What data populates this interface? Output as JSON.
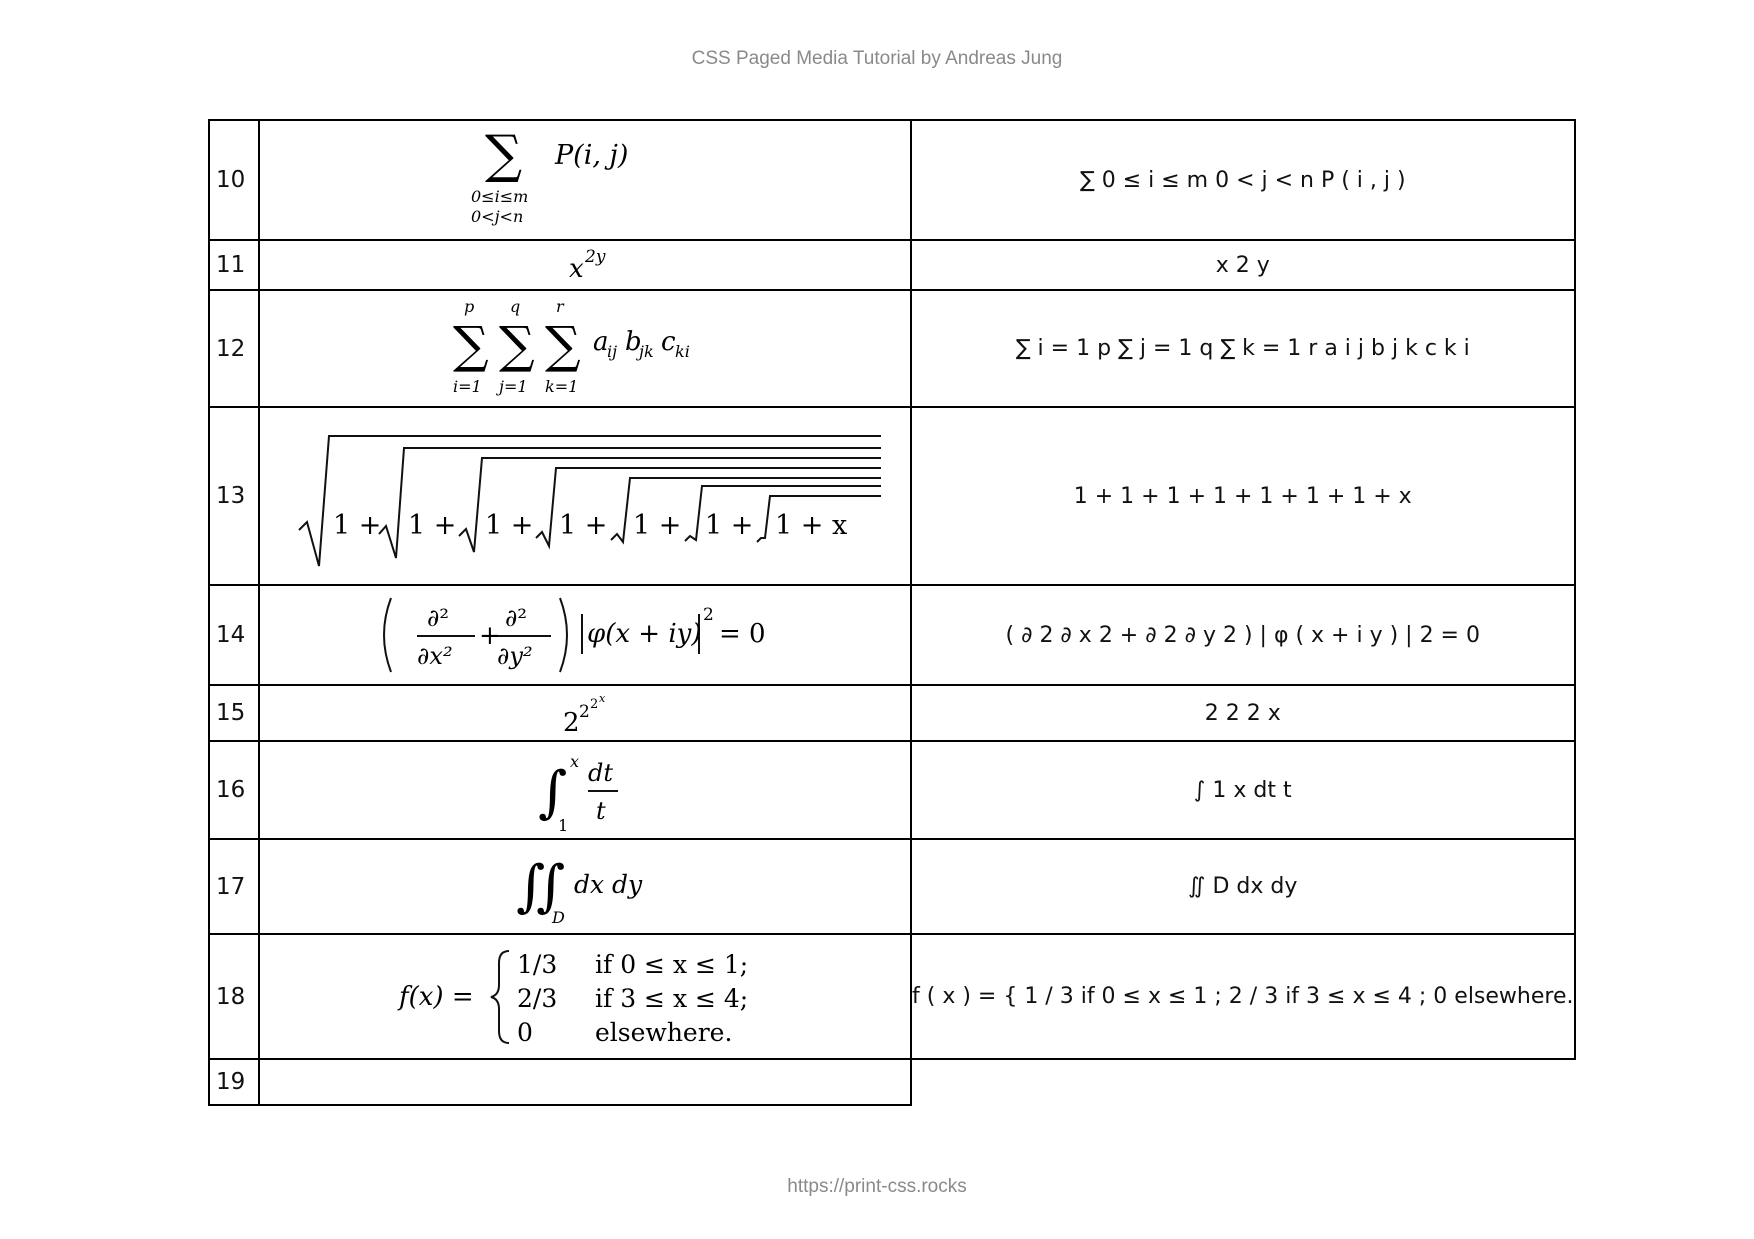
{
  "header": {
    "running_title": "CSS Paged Media Tutorial by Andreas Jung"
  },
  "footer": {
    "url": "https://print-css.rocks"
  },
  "rows": [
    {
      "number": "10",
      "formula": {
        "main": "P(i, j)",
        "sub1": "0≤i≤m",
        "sub2": "0<j<n",
        "op": "∑"
      },
      "text": "∑ 0 ≤ i ≤ m 0 < j < n P ( i , j )"
    },
    {
      "number": "11",
      "formula": {
        "base": "x",
        "exp": "2y"
      },
      "text": "x 2 y"
    },
    {
      "number": "12",
      "formula": {
        "op": "∑",
        "sup1": "p",
        "sub1": "i=1",
        "sup2": "q",
        "sub2": "j=1",
        "sup3": "r",
        "sub3": "k=1",
        "a": "a",
        "a_sub": "ij",
        "b": "b",
        "b_sub": "jk",
        "c": "c",
        "c_sub": "ki"
      },
      "text": "∑ i = 1 p ∑ j = 1 q ∑ k = 1 r a i j b j k c k i"
    },
    {
      "number": "13",
      "formula": {
        "term": "1 +",
        "last": "1 + x"
      },
      "text": "1 + 1 + 1 + 1 + 1 + 1 + 1 + x"
    },
    {
      "number": "14",
      "formula": {
        "d2": "∂²",
        "dx2": "∂x²",
        "dy2": "∂y²",
        "plus": "+",
        "phi": "φ(x + iy)",
        "pow": "2",
        "eq": "= 0"
      },
      "text": "( ∂ 2 ∂ x 2 + ∂ 2 ∂ y 2 ) | φ ( x + i y ) | 2 = 0"
    },
    {
      "number": "15",
      "formula": {
        "b1": "2",
        "b2": "2",
        "b3": "2",
        "b4": "x"
      },
      "text": "2 2 2 x"
    },
    {
      "number": "16",
      "formula": {
        "upper": "x",
        "lower": "1",
        "num": "dt",
        "den": "t"
      },
      "text": "∫ 1 x dt t"
    },
    {
      "number": "17",
      "formula": {
        "region": "D",
        "body": "dx dy"
      },
      "text": "∬ D dx dy"
    },
    {
      "number": "18",
      "formula": {
        "lhs": "f(x) =",
        "v1": "1/3",
        "c1": "if 0 ≤ x ≤ 1;",
        "v2": "2/3",
        "c2": "if 3 ≤ x ≤ 4;",
        "v3": "0",
        "c3": "elsewhere."
      },
      "text": "f ( x ) = { 1 / 3 if  0 ≤ x ≤ 1 ; 2 / 3 if  3 ≤ x ≤ 4 ; 0 elsewhere."
    },
    {
      "number": "19",
      "formula": {},
      "text": ""
    }
  ]
}
